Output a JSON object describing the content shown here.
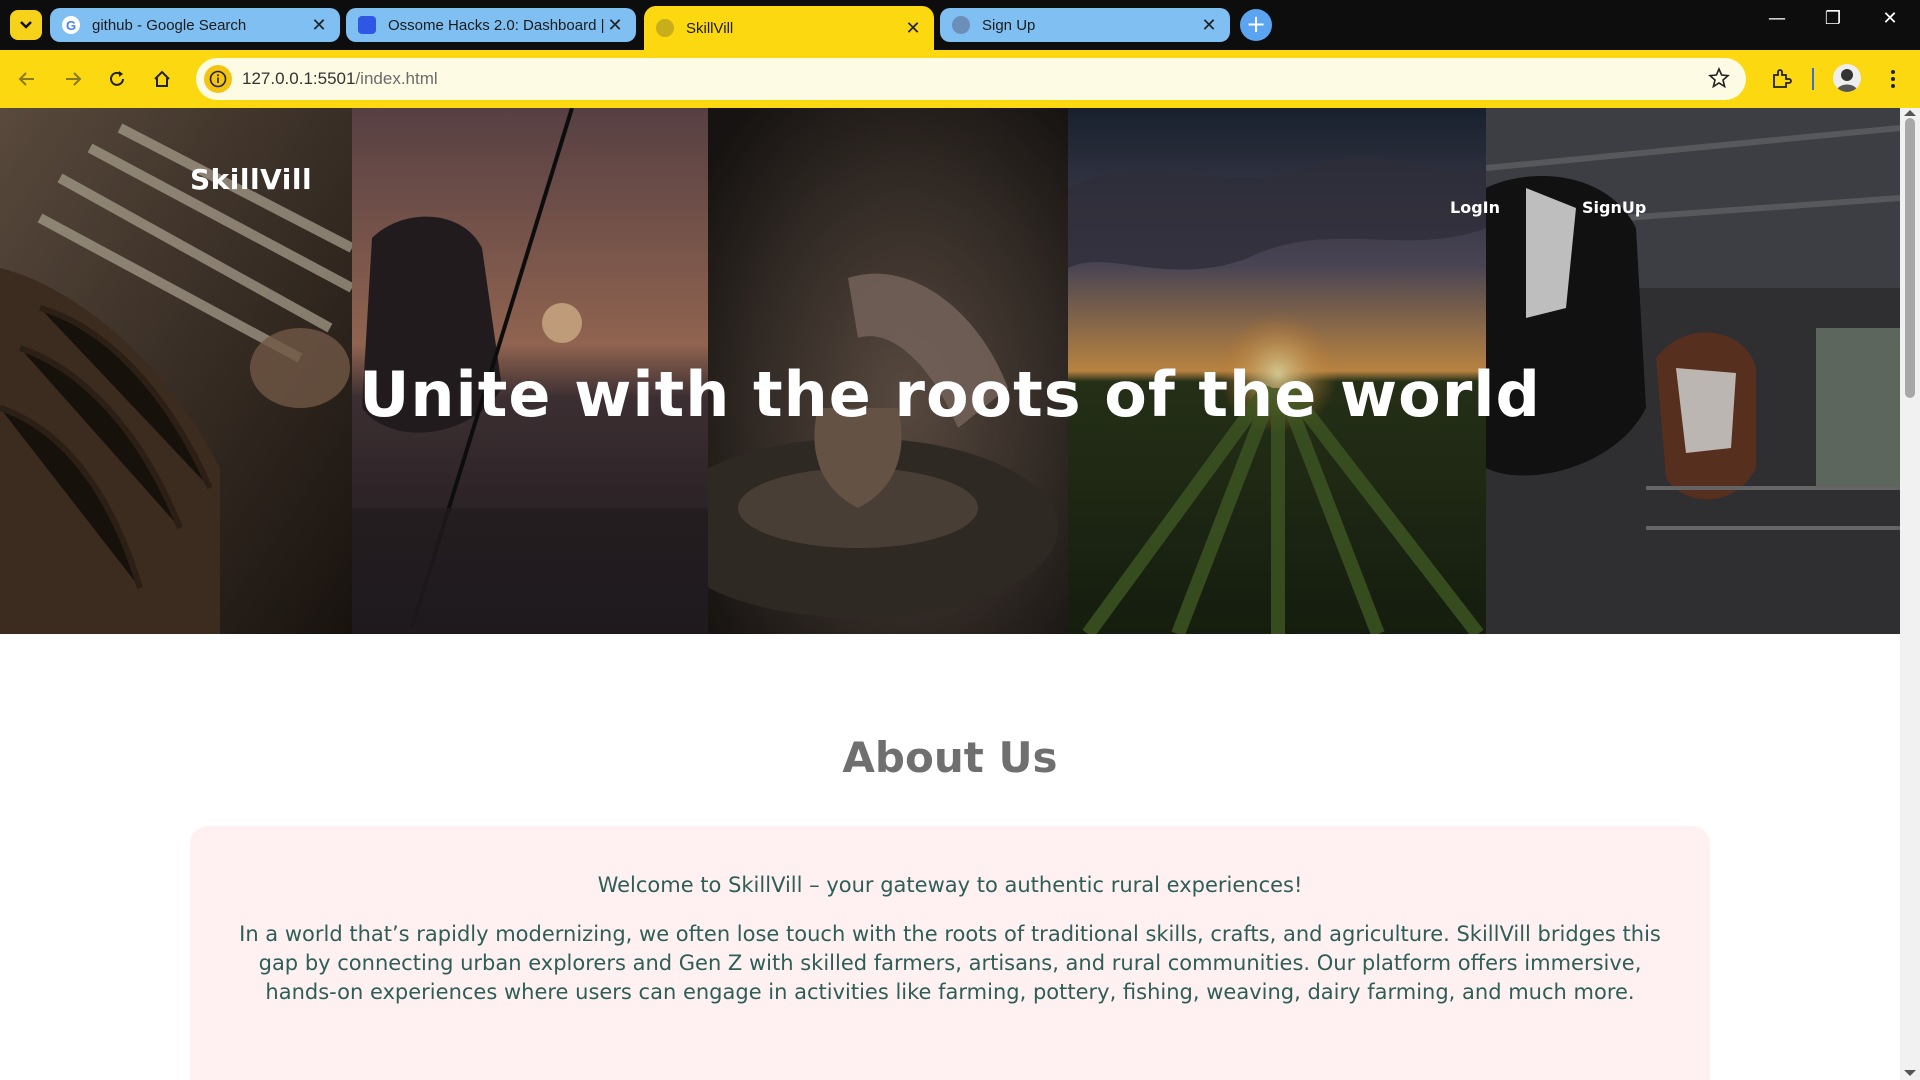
{
  "browser": {
    "tabs": [
      {
        "title": "github - Google Search",
        "favicon": "google-icon",
        "active": false
      },
      {
        "title": "Ossome Hacks 2.0: Dashboard |",
        "favicon": "site-icon",
        "active": false
      },
      {
        "title": "SkillVill",
        "favicon": "globe-icon",
        "active": true
      },
      {
        "title": "Sign Up",
        "favicon": "globe-icon",
        "active": false
      }
    ],
    "url_host": "127.0.0.1:5501",
    "url_path": "/index.html",
    "accent_color": "#fbd80f"
  },
  "page": {
    "brand": "SkillVill",
    "nav": {
      "login": "LogIn",
      "signup": "SignUp"
    },
    "hero_title": "Unite with the roots of the world",
    "about": {
      "heading": "About Us",
      "welcome": "Welcome to SkillVill – your gateway to authentic rural experiences!",
      "body": "In a world that’s rapidly modernizing, we often lose touch with the roots of traditional skills, crafts, and agriculture. SkillVill bridges this gap by connecting urban explorers and Gen Z with skilled farmers, artisans, and rural communities. Our platform offers immersive, hands-on experiences where users can engage in activities like farming, pottery, fishing, weaving, dairy farming, and much more."
    }
  }
}
